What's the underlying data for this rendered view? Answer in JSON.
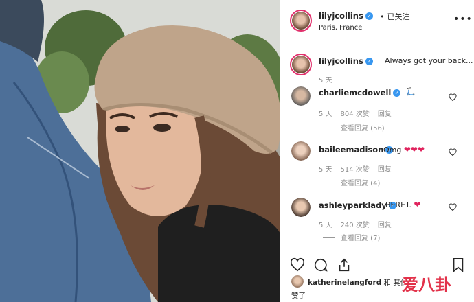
{
  "post": {
    "username": "lilyjcollins",
    "follow_status": "已关注",
    "location": "Paris, France",
    "more_label": "•••"
  },
  "caption": {
    "username": "lilyjcollins",
    "text": "Always got your back...",
    "age": "5 天"
  },
  "comments": [
    {
      "username": "charliemcdowell",
      "text": "🛴",
      "age": "5 天",
      "likes": "804 次赞",
      "reply_label": "回复",
      "view_replies": "查看回复 (56)"
    },
    {
      "username": "baileemadison",
      "text": "Omg",
      "age": "5 天",
      "likes": "514 次赞",
      "reply_label": "回复",
      "view_replies": "查看回复 (4)"
    },
    {
      "username": "ashleyparklady",
      "text": "BERET.",
      "age": "5 天",
      "likes": "240 次赞",
      "reply_label": "回复",
      "view_replies": "查看回复 (7)"
    }
  ],
  "likes_line": {
    "username": "katherinelangford",
    "text_mid": " 和 其他",
    "text_end": "赞了"
  },
  "watermark": "爱八卦",
  "icons": {
    "like": "heart-icon",
    "comment": "comment-icon",
    "share": "share-icon",
    "save": "bookmark-icon"
  },
  "colors": {
    "verified": "#3897f0",
    "heart_red": "#e0245e",
    "story_ring": "#e1306c",
    "watermark": "#e2324a"
  }
}
